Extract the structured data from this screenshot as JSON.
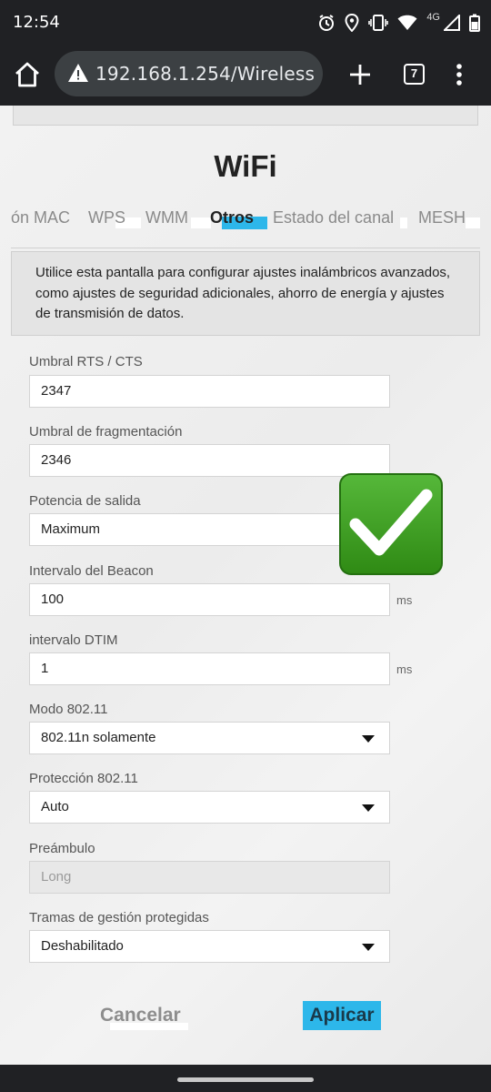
{
  "status_bar": {
    "time": "12:54",
    "network_label": "4G",
    "icons": [
      "alarm-icon",
      "location-icon",
      "vibrate-icon",
      "wifi-icon",
      "signal-icon",
      "battery-icon"
    ]
  },
  "browser": {
    "url": "192.168.1.254/Wireless",
    "tab_count": "7",
    "icons": [
      "home-icon",
      "warning-icon",
      "plus-icon",
      "tabs-icon",
      "more-vert-icon"
    ]
  },
  "page": {
    "title": "WiFi",
    "tabs": [
      {
        "label": "ón MAC"
      },
      {
        "label": "WPS"
      },
      {
        "label": "WMM"
      },
      {
        "label": "Otros"
      },
      {
        "label": "Estado del canal"
      },
      {
        "label": "MESH"
      }
    ],
    "active_tab": "Otros",
    "info_text": "Utilice esta pantalla para configurar ajustes inalámbricos avanzados, como ajustes de seguridad adicionales, ahorro de energía y ajustes de transmisión de datos.",
    "fields": {
      "rts": {
        "label": "Umbral RTS / CTS",
        "value": "2347"
      },
      "frag": {
        "label": "Umbral de fragmentación",
        "value": "2346"
      },
      "power": {
        "label": "Potencia de salida",
        "value": "Maximum"
      },
      "beacon": {
        "label": "Intervalo del Beacon",
        "value": "100",
        "unit": "ms"
      },
      "dtim": {
        "label": "intervalo DTIM",
        "value": "1",
        "unit": "ms"
      },
      "mode": {
        "label": "Modo 802.11",
        "value": "802.11n solamente"
      },
      "protection": {
        "label": "Protección 802.11",
        "value": "Auto"
      },
      "preamble": {
        "label": "Preámbulo",
        "value": "Long"
      },
      "pmf": {
        "label": "Tramas de gestión protegidas",
        "value": "Deshabilitado"
      }
    },
    "buttons": {
      "cancel": "Cancelar",
      "apply": "Aplicar"
    }
  },
  "colors": {
    "accent": "#2db7ea",
    "checkmark_green": "#3a9a1e",
    "browser_chrome": "#202124"
  }
}
